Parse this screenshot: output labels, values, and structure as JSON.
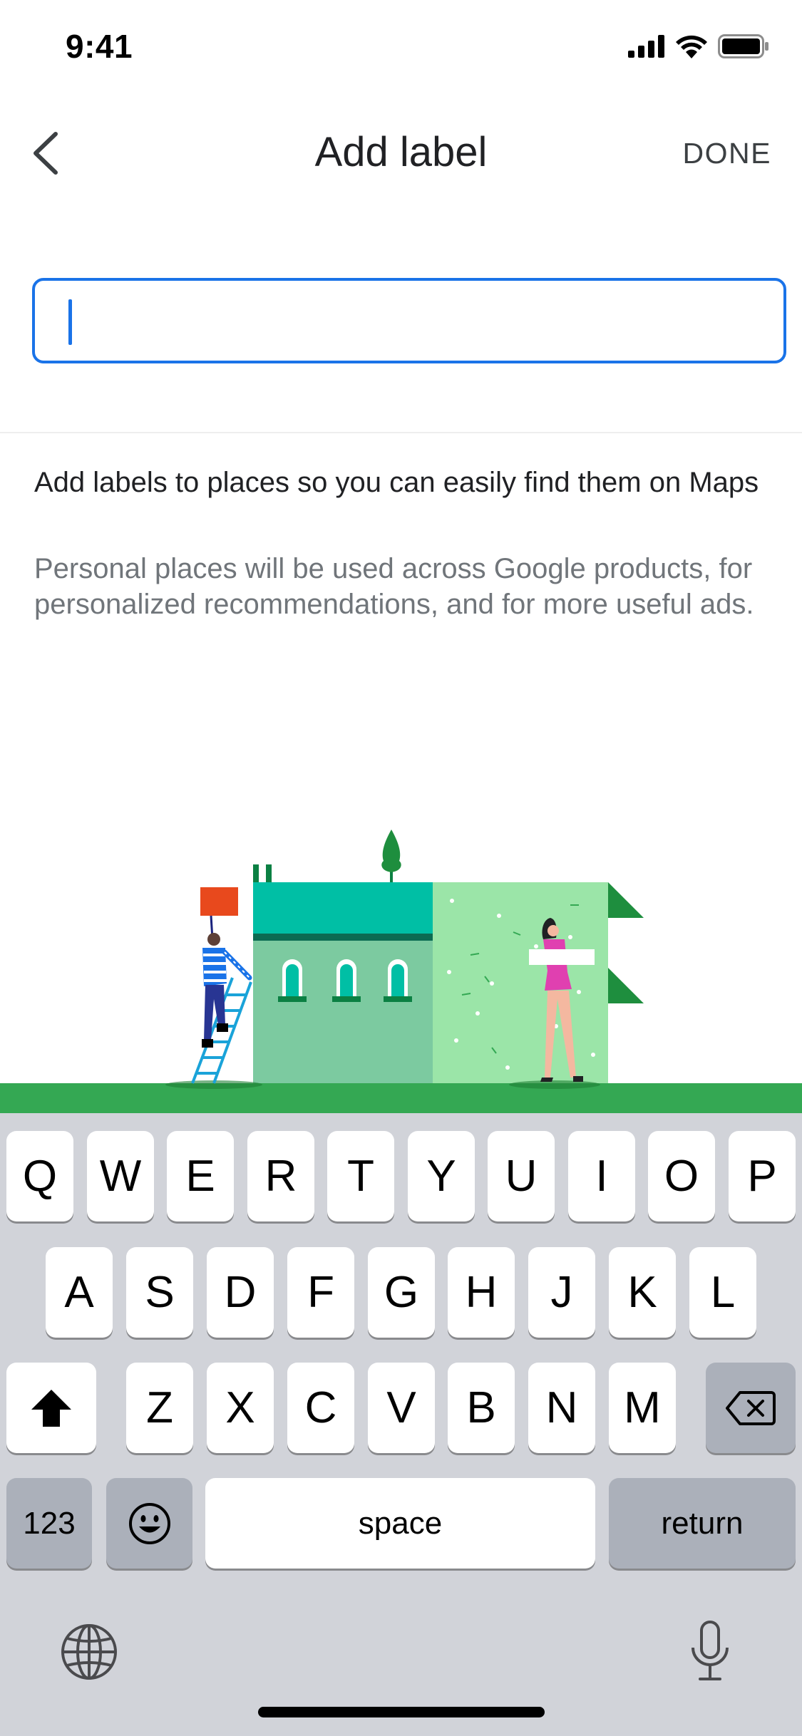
{
  "status_bar": {
    "time": "9:41"
  },
  "header": {
    "title": "Add label",
    "done_label": "DONE"
  },
  "label_input": {
    "value": "",
    "placeholder": ""
  },
  "info": {
    "title": "Add labels to places so you can easily find them on Maps",
    "body": "Personal places will be used across Google products, for personalized recommendations, and for more useful ads."
  },
  "keyboard": {
    "row1": [
      "Q",
      "W",
      "E",
      "R",
      "T",
      "Y",
      "U",
      "I",
      "O",
      "P"
    ],
    "row2": [
      "A",
      "S",
      "D",
      "F",
      "G",
      "H",
      "J",
      "K",
      "L"
    ],
    "row3": [
      "Z",
      "X",
      "C",
      "V",
      "B",
      "N",
      "M"
    ],
    "numbers_label": "123",
    "space_label": "space",
    "return_label": "return"
  },
  "icons": {
    "back": "chevron-left-icon",
    "signal": "cellular-signal-icon",
    "wifi": "wifi-icon",
    "battery": "battery-icon",
    "shift": "shift-icon",
    "delete": "backspace-icon",
    "emoji": "emoji-icon",
    "globe": "globe-icon",
    "mic": "microphone-icon"
  },
  "colors": {
    "accent": "#1a73e8",
    "ground_green": "#34a853",
    "keyboard_bg": "#d1d3d9"
  }
}
